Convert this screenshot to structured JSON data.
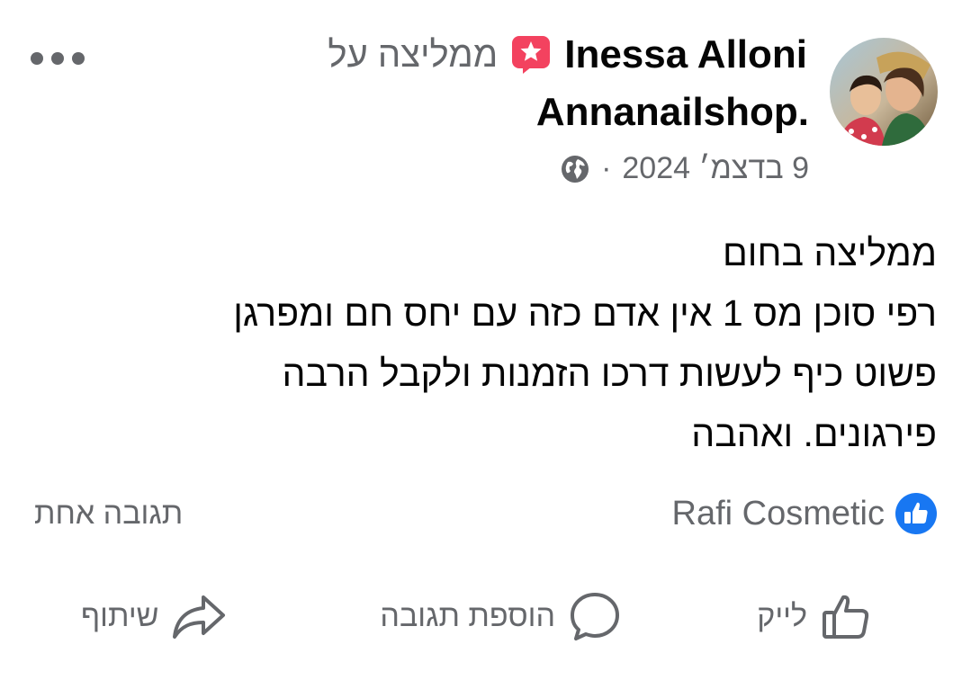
{
  "post": {
    "author": "Inessa Alloni",
    "recommends_text": "ממליצה על",
    "page_name": "Annanailshop.",
    "date": "9 בדצמ׳ 2024",
    "separator": "·",
    "audience_icon": "globe-icon",
    "body_lines": [
      "ממליצה בחום",
      "רפי סוכן מס 1 אין אדם כזה עם יחס חם ומפרגן",
      "פשוט כיף לעשות דרכו הזמנות ולקבל הרבה",
      "פירגונים. ואהבה"
    ],
    "reaction_name": "Rafi Cosmetic",
    "reply_count": "תגובה אחת"
  },
  "actions": {
    "like": "לייק",
    "comment": "הוספת תגובה",
    "share": "שיתוף"
  },
  "colors": {
    "recommend_badge": "#f3425f",
    "like_badge": "#1877f2",
    "secondary_text": "#65676b"
  }
}
